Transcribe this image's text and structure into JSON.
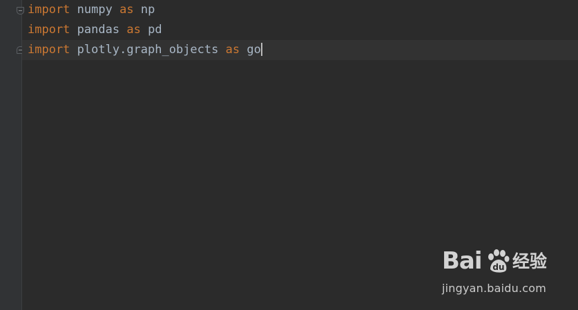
{
  "editor": {
    "lines": [
      {
        "keyword": "import",
        "module": "numpy",
        "as_keyword": "as",
        "alias": "np"
      },
      {
        "keyword": "import",
        "module": "pandas",
        "as_keyword": "as",
        "alias": "pd"
      },
      {
        "keyword": "import",
        "module": "plotly.graph_objects",
        "as_keyword": "as",
        "alias": "go"
      }
    ]
  },
  "watermark": {
    "logo_text": "Bai",
    "logo_suffix": "经验",
    "url": "jingyan.baidu.com",
    "paw_icon": "baidu-paw-icon"
  },
  "colors": {
    "background": "#2b2b2b",
    "keyword": "#cc7832",
    "identifier": "#a9b7c6",
    "gutter": "#313335"
  }
}
